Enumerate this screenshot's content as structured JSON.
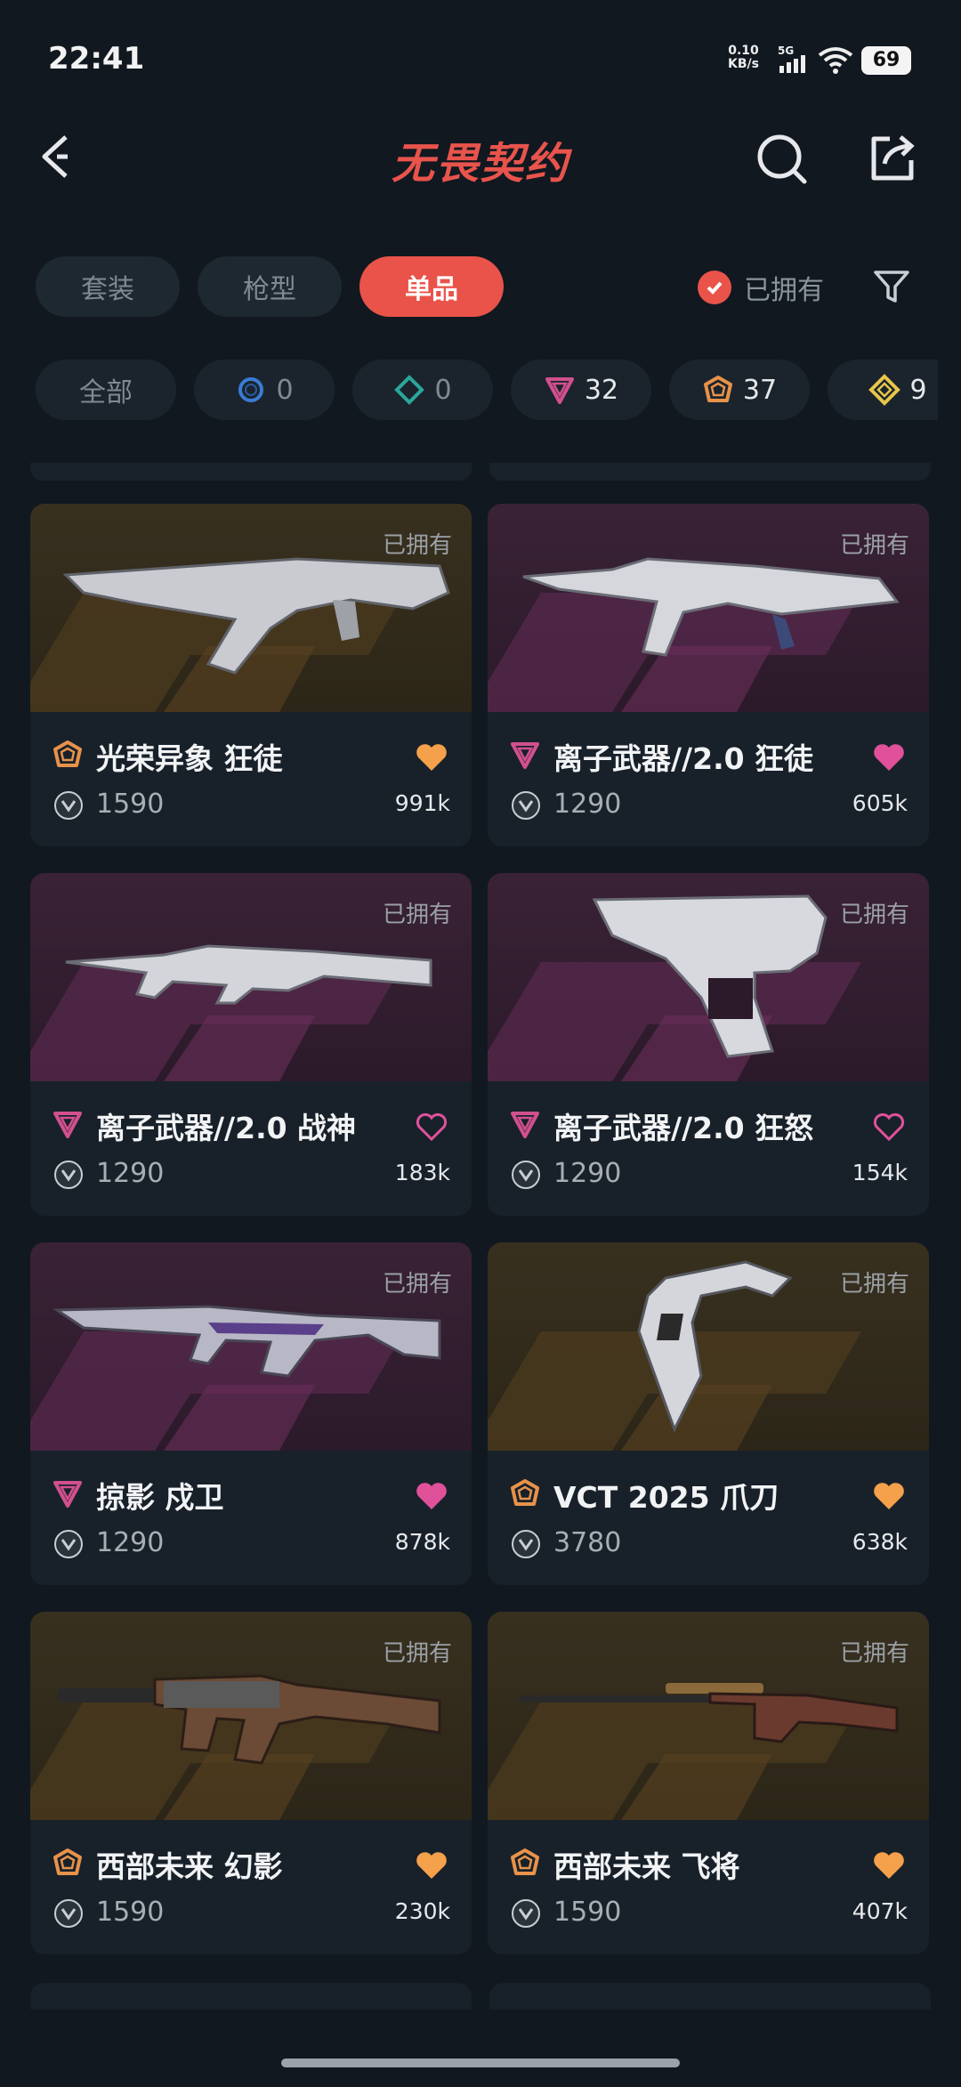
{
  "status_bar": {
    "time": "22:41",
    "net_speed_value": "0.10",
    "net_speed_unit": "KB/s",
    "network": "5G",
    "battery": "69"
  },
  "header": {
    "title": "无畏契约",
    "title_color": "#e8544c",
    "back_icon": "back-arrow-icon",
    "search_icon": "search-icon",
    "share_icon": "share-icon"
  },
  "tabs": [
    {
      "label": "套装",
      "active": false
    },
    {
      "label": "枪型",
      "active": false
    },
    {
      "label": "单品",
      "active": true
    }
  ],
  "owned_filter": {
    "label": "已拥有",
    "checked": true
  },
  "rarity_chips": [
    {
      "label": "全部",
      "count": ""
    },
    {
      "label": "",
      "count": "0",
      "icon": "select-tier-icon"
    },
    {
      "label": "",
      "count": "0",
      "icon": "deluxe-tier-icon"
    },
    {
      "label": "",
      "count": "32",
      "icon": "premium-tier-icon"
    },
    {
      "label": "",
      "count": "37",
      "icon": "exclusive-tier-icon"
    },
    {
      "label": "",
      "count": "9",
      "icon": "ultra-tier-icon"
    }
  ],
  "items": [
    {
      "name": "光荣异象 狂徒",
      "tier": "exclusive",
      "price": "1590",
      "likes": "991k",
      "owned_label": "已拥有",
      "liked": true
    },
    {
      "name": "离子武器//2.0 狂徒",
      "tier": "premium",
      "price": "1290",
      "likes": "605k",
      "owned_label": "已拥有",
      "liked": true
    },
    {
      "name": "离子武器//2.0 战神",
      "tier": "premium",
      "price": "1290",
      "likes": "183k",
      "owned_label": "已拥有",
      "liked": false
    },
    {
      "name": "离子武器//2.0 狂怒",
      "tier": "premium",
      "price": "1290",
      "likes": "154k",
      "owned_label": "已拥有",
      "liked": false
    },
    {
      "name": "掠影 戍卫",
      "tier": "premium",
      "price": "1290",
      "likes": "878k",
      "owned_label": "已拥有",
      "liked": true
    },
    {
      "name": "VCT 2025 爪刀",
      "tier": "exclusive",
      "price": "3780",
      "likes": "638k",
      "owned_label": "已拥有",
      "liked": true
    },
    {
      "name": "西部未来 幻影",
      "tier": "exclusive",
      "price": "1590",
      "likes": "230k",
      "owned_label": "已拥有",
      "liked": true
    },
    {
      "name": "西部未来 飞将",
      "tier": "exclusive",
      "price": "1590",
      "likes": "407k",
      "owned_label": "已拥有",
      "liked": true
    }
  ],
  "colors": {
    "accent": "#e9534a",
    "premium": "#d2508f",
    "exclusive": "#e8924a",
    "heart_premium": "#e0519a",
    "heart_exclusive": "#f5a04a"
  }
}
